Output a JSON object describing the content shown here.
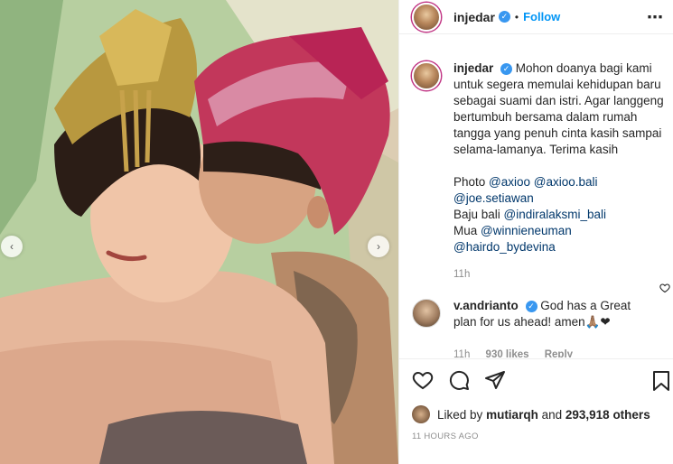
{
  "post": {
    "username": "injedar",
    "follow_label": "Follow",
    "dot": "•",
    "more_icon": "⋯"
  },
  "caption": {
    "username": "injedar",
    "text": "Mohon doanya bagi kami untuk segera memulai kehidupan baru sebagai suami dan istri. Agar langgeng bertumbuh bersama dalam rumah tangga yang penuh cinta kasih sampai selama-lamanya. Terima kasih",
    "credits": [
      {
        "prefix": "Photo ",
        "tags": [
          "@axioo",
          "@axioo.bali"
        ]
      },
      {
        "prefix": "",
        "tags": [
          "@joe.setiawan"
        ]
      },
      {
        "prefix": "Baju bali ",
        "tags": [
          "@indiralaksmi_bali"
        ]
      },
      {
        "prefix": "Mua ",
        "tags": [
          "@winnieneuman",
          "@hairdo_bydevina"
        ]
      }
    ],
    "time": "11h"
  },
  "comment": {
    "username": "v.andrianto",
    "text": "God has a Great plan for us ahead! amen🙏🏽❤",
    "time": "11h",
    "likes": "930 likes",
    "reply": "Reply"
  },
  "likes_line": {
    "prefix": "Liked by ",
    "user": "mutiarqh",
    "middle": " and ",
    "count": "293,918 others"
  },
  "post_time": "11 HOURS AGO",
  "nav": {
    "prev": "‹",
    "next": "›"
  },
  "colors": {
    "accent": "#0095f6",
    "verified": "#3897f0",
    "tag": "#00376b"
  }
}
